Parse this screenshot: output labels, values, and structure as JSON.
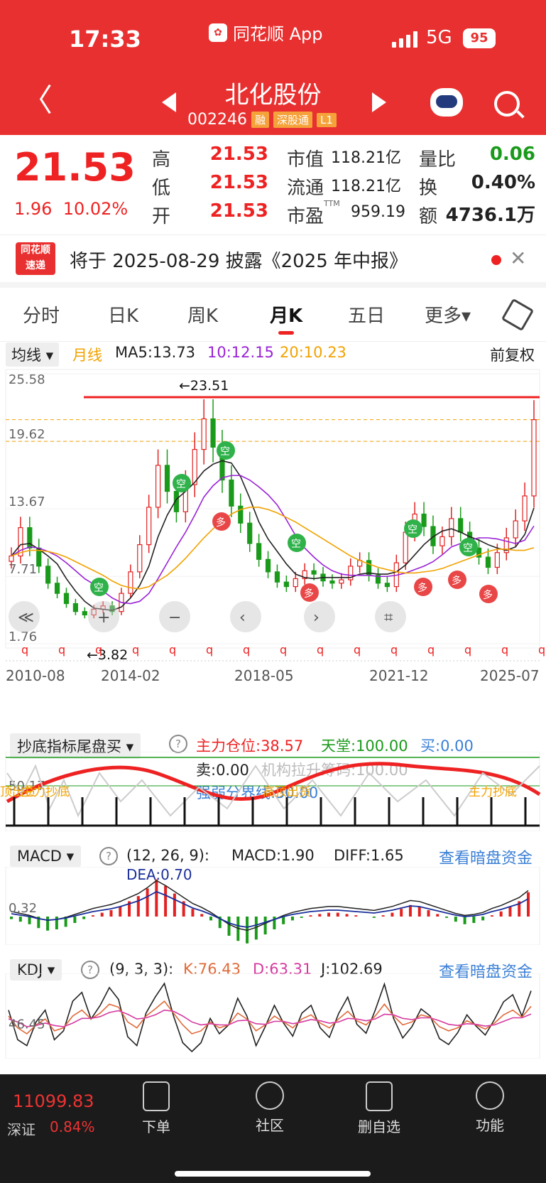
{
  "status_bar": {
    "time": "17:33",
    "app_name": "同花顺 App",
    "network": "5G",
    "battery": "95"
  },
  "header": {
    "title": "北化股份",
    "code": "002246",
    "tags": [
      "融",
      "深股通",
      "L1"
    ]
  },
  "quote": {
    "price": "21.53",
    "change": "1.96",
    "change_pct": "10.02%",
    "high_label": "高",
    "high": "21.53",
    "low_label": "低",
    "low": "21.53",
    "open_label": "开",
    "open": "21.53",
    "mcap_label": "市值",
    "mcap": "118.21亿",
    "float_label": "流通",
    "float": "118.21亿",
    "pe_label": "市盈",
    "pe_sup": "TTM",
    "pe": "959.19",
    "vol_ratio_label": "量比",
    "vol_ratio": "0.06",
    "turnover_label": "换",
    "turnover": "0.40%",
    "amount_label": "额",
    "amount": "4736.1万"
  },
  "notice": {
    "logo_line1": "同花顺",
    "logo_line2": "速递",
    "text": "将于 2025-08-29 披露《2025 年中报》",
    "close": "✕"
  },
  "tabs": [
    {
      "label": "分时"
    },
    {
      "label": "日K"
    },
    {
      "label": "周K"
    },
    {
      "label": "月K"
    },
    {
      "label": "五日"
    },
    {
      "label": "更多▾"
    }
  ],
  "ma_row": {
    "selector": "均线 ▾",
    "period": "月线",
    "ma5": "MA5:13.73",
    "ma10": "10:12.15",
    "ma20": "20:10.23",
    "adjust": "前复权"
  },
  "colors": {
    "red": "#e22222",
    "green": "#1a9a1a",
    "ma5": "#222222",
    "ma10": "#9a22d6",
    "ma20": "#f2a200"
  },
  "chart_data": [
    {
      "type": "candlestick",
      "title": "北化股份 月K",
      "y_ticks": [
        "25.58",
        "19.62",
        "13.67",
        "7.71",
        "1.76"
      ],
      "x_ticks": [
        "2010-08",
        "2014-02",
        "2018-05",
        "2021-12",
        "2025-07"
      ],
      "ylim": [
        1.76,
        25.58
      ],
      "annotations": [
        "←23.51",
        "←3.82"
      ],
      "close_series": [
        9.5,
        12,
        10.2,
        8.6,
        7.1,
        6.2,
        5.3,
        4.6,
        4.3,
        4.8,
        5.1,
        4.6,
        6.2,
        8.1,
        10.5,
        13.8,
        17.5,
        15.2,
        13.4,
        15.8,
        18.9,
        21.6,
        19.1,
        16.2,
        13.9,
        12.4,
        10.6,
        9.2,
        8.1,
        7.2,
        6.8,
        7.5,
        8.2,
        7.9,
        7.3,
        7.1,
        7.4,
        8.6,
        9.1,
        7.8,
        7.1,
        6.8,
        8.9,
        11.6,
        13.2,
        12.1,
        10.4,
        11.2,
        12.8,
        11.6,
        10.2,
        9.4,
        8.5,
        9.8,
        11.1,
        12.6,
        14.8,
        21.53
      ],
      "ma5": [
        9.5,
        10.5,
        10.6,
        10.1,
        9.5,
        8.8,
        7.5,
        6.4,
        5.5,
        4.9,
        4.8,
        4.7,
        5.0,
        5.8,
        6.9,
        8.6,
        11.2,
        13.1,
        14.5,
        15.2,
        16.0,
        17.0,
        17.6,
        17.9,
        17.7,
        16.5,
        14.6,
        12.5,
        11.0,
        9.9,
        8.8,
        7.9,
        7.6,
        7.5,
        7.6,
        7.6,
        7.6,
        7.6,
        7.9,
        8.0,
        7.9,
        7.9,
        8.1,
        8.7,
        9.6,
        10.5,
        11.2,
        11.7,
        11.9,
        11.6,
        11.2,
        10.9,
        10.5,
        10.2,
        10.0,
        10.3,
        11.4,
        13.73
      ],
      "ma10": [
        9.5,
        10.0,
        10.3,
        10.2,
        9.9,
        9.5,
        8.9,
        8.2,
        7.5,
        7.0,
        6.4,
        5.8,
        5.4,
        5.3,
        5.5,
        6.2,
        7.5,
        8.9,
        10.3,
        11.6,
        13.1,
        14.7,
        15.7,
        16.4,
        16.6,
        16.6,
        16.2,
        15.6,
        14.9,
        14.0,
        12.7,
        11.3,
        10.2,
        9.4,
        8.7,
        8.2,
        7.9,
        7.8,
        7.8,
        7.8,
        7.7,
        7.7,
        7.8,
        8.0,
        8.3,
        8.6,
        9.0,
        9.6,
        10.3,
        10.6,
        10.9,
        11.1,
        11.1,
        11.0,
        10.8,
        10.6,
        10.9,
        12.15
      ],
      "ma20": [
        9.5,
        9.8,
        10.0,
        10.0,
        9.9,
        9.7,
        9.4,
        9.0,
        8.6,
        8.2,
        7.8,
        7.3,
        6.9,
        6.7,
        6.6,
        6.8,
        7.3,
        7.8,
        8.5,
        9.3,
        10.2,
        11.1,
        11.9,
        12.6,
        13.2,
        13.6,
        13.8,
        13.8,
        13.6,
        13.3,
        12.9,
        12.5,
        12.0,
        11.5,
        11.0,
        10.5,
        10.0,
        9.5,
        9.1,
        8.8,
        8.5,
        8.3,
        8.1,
        8.0,
        8.0,
        8.1,
        8.2,
        8.4,
        8.7,
        9.0,
        9.3,
        9.6,
        9.9,
        10.1,
        10.1,
        10.0,
        10.0,
        10.23
      ]
    },
    {
      "type": "line",
      "title": "抄底指标尾盘买",
      "labels": [
        "主力仓位:38.57",
        "天堂:100.00",
        "买:0.00",
        "卖:0.00",
        "机构拉升筹码:100.00",
        "强弱分界线:50.00"
      ],
      "y_ticks": [
        "50.17"
      ],
      "signal_text": [
        "顶出货",
        "主力抄底",
        "高顶出货",
        "主力抄底"
      ]
    },
    {
      "type": "bar",
      "title": "MACD",
      "params": "(12, 26, 9):",
      "labels": [
        "MACD:1.90",
        "DIFF:1.65",
        "DEA:0.70"
      ],
      "y_ticks": [
        "0.32"
      ],
      "values": [
        -0.2,
        -0.4,
        -0.6,
        -0.9,
        -1.1,
        -1.0,
        -0.8,
        -0.5,
        -0.2,
        0.1,
        0.3,
        0.5,
        0.8,
        1.2,
        1.6,
        2.2,
        2.9,
        2.4,
        1.8,
        1.2,
        0.6,
        0.2,
        -0.3,
        -0.9,
        -1.5,
        -1.9,
        -2.1,
        -1.8,
        -1.4,
        -1.0,
        -0.6,
        -0.3,
        -0.1,
        0.1,
        0.2,
        0.3,
        0.3,
        0.2,
        0.1,
        0.0,
        -0.1,
        0.1,
        0.3,
        0.6,
        0.9,
        0.8,
        0.5,
        0.2,
        -0.1,
        -0.4,
        -0.6,
        -0.5,
        -0.3,
        0.1,
        0.4,
        0.8,
        1.2,
        1.9
      ]
    },
    {
      "type": "line",
      "title": "KDJ",
      "params": "(9, 3, 3):",
      "labels": [
        "K:76.43",
        "D:63.31",
        "J:102.69"
      ],
      "y_ticks": [
        "46.45"
      ],
      "k": [
        60,
        40,
        30,
        45,
        55,
        35,
        40,
        60,
        70,
        55,
        65,
        80,
        75,
        50,
        40,
        60,
        72,
        85,
        65,
        45,
        30,
        35,
        50,
        40,
        45,
        65,
        55,
        35,
        45,
        60,
        50,
        40,
        55,
        62,
        48,
        40,
        55,
        68,
        52,
        45,
        60,
        80,
        60,
        45,
        50,
        62,
        58,
        42,
        35,
        40,
        52,
        45,
        38,
        48,
        62,
        70,
        58,
        76.43
      ],
      "d": [
        55,
        50,
        42,
        44,
        48,
        44,
        42,
        48,
        56,
        56,
        59,
        66,
        69,
        63,
        55,
        57,
        62,
        70,
        68,
        60,
        50,
        45,
        47,
        45,
        45,
        52,
        53,
        47,
        46,
        51,
        51,
        47,
        50,
        54,
        52,
        48,
        50,
        56,
        55,
        52,
        55,
        63,
        62,
        56,
        54,
        57,
        57,
        52,
        46,
        44,
        47,
        46,
        43,
        45,
        51,
        57,
        57,
        63.31
      ],
      "j": [
        70,
        20,
        10,
        50,
        70,
        20,
        35,
        85,
        100,
        55,
        78,
        108,
        88,
        25,
        10,
        65,
        92,
        115,
        60,
        15,
        0,
        15,
        56,
        30,
        45,
        90,
        60,
        10,
        42,
        78,
        48,
        26,
        65,
        78,
        40,
        24,
        64,
        92,
        46,
        31,
        70,
        114,
        56,
        23,
        42,
        72,
        60,
        22,
        12,
        32,
        62,
        43,
        28,
        54,
        84,
        96,
        60,
        102.69
      ]
    }
  ],
  "indicator1": {
    "selector": "抄底指标尾盘买 ▾",
    "help": "?"
  },
  "indicator2": {
    "selector": "MACD ▾",
    "help": "?",
    "link": "查看暗盘资金"
  },
  "indicator3": {
    "selector": "KDJ ▾",
    "help": "?",
    "link": "查看暗盘资金"
  },
  "bottom_nav": {
    "index_value": "11099.83",
    "index_name": "深证",
    "index_change": "0.84%",
    "items": [
      {
        "label": "下单"
      },
      {
        "label": "社区"
      },
      {
        "label": "删自选"
      },
      {
        "label": "功能"
      }
    ]
  }
}
